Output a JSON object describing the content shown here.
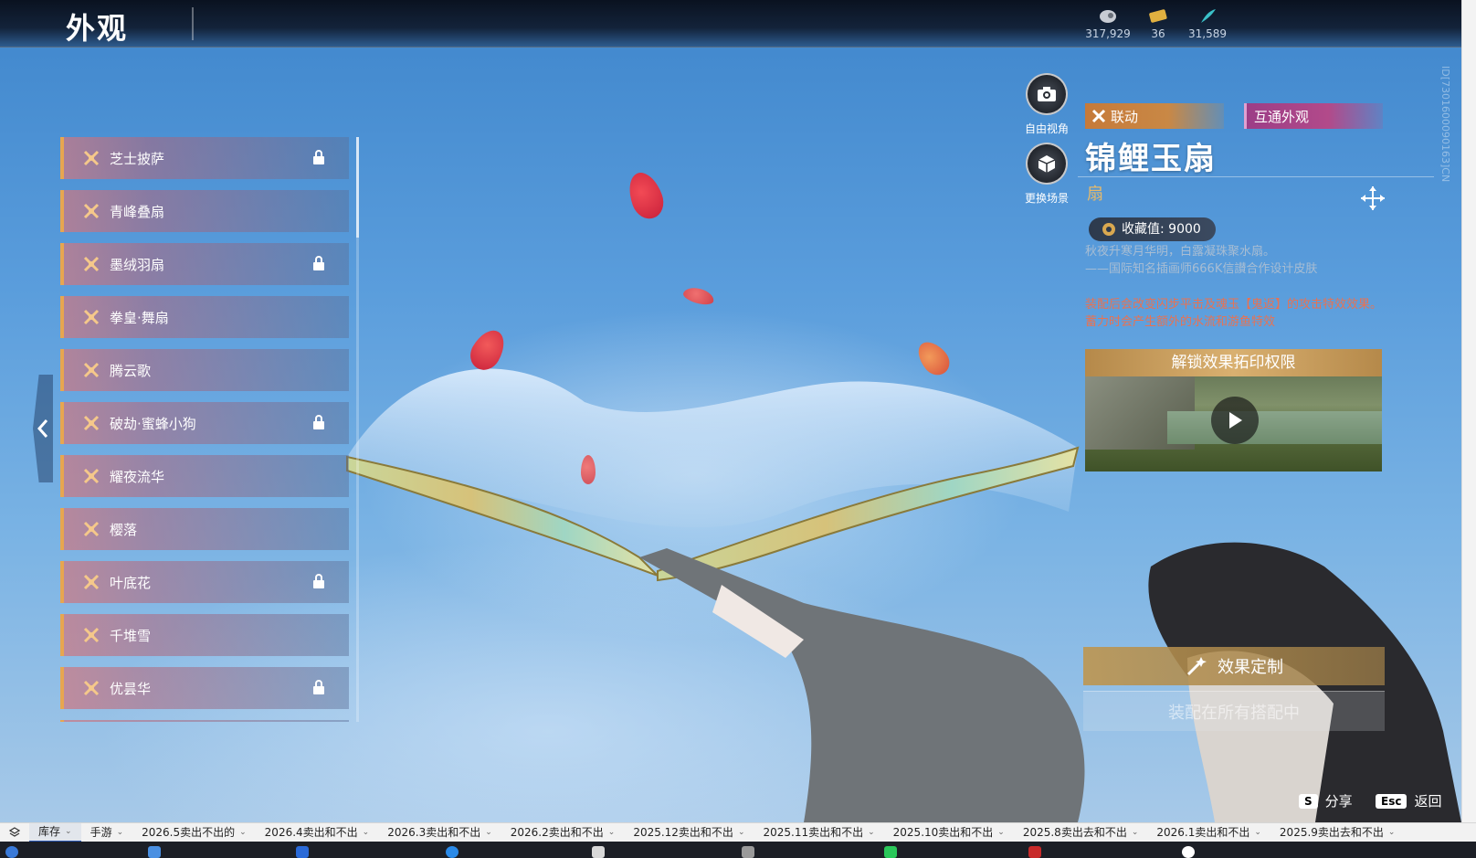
{
  "header": {
    "title": "外观",
    "currencies": [
      {
        "icon": "shell-currency-icon",
        "value": "317,929"
      },
      {
        "icon": "ticket-currency-icon",
        "value": "36"
      },
      {
        "icon": "feather-currency-icon",
        "value": "31,589"
      }
    ]
  },
  "camera": {
    "free_view_label": "自由视角",
    "change_scene_label": "更换场景"
  },
  "skin_list": [
    {
      "name": "芝士披萨",
      "locked": true
    },
    {
      "name": "青峰叠扇",
      "locked": false
    },
    {
      "name": "墨绒羽扇",
      "locked": true
    },
    {
      "name": "拳皇·舞扇",
      "locked": false
    },
    {
      "name": "腾云歌",
      "locked": false
    },
    {
      "name": "破劫·蜜蜂小狗",
      "locked": true
    },
    {
      "name": "耀夜流华",
      "locked": false
    },
    {
      "name": "樱落",
      "locked": false
    },
    {
      "name": "叶底花",
      "locked": true
    },
    {
      "name": "千堆雪",
      "locked": false
    },
    {
      "name": "优昙华",
      "locked": true
    }
  ],
  "detail": {
    "tag_collab": "联动",
    "tag_shared": "互通外观",
    "name": "锦鲤玉扇",
    "type": "扇",
    "collect_value": "收藏值: 9000",
    "desc_line1": "秋夜升寒月华明，白露凝珠聚水扇。",
    "desc_line2": "——国际知名插画师666K信讃合作设计皮肤",
    "effect_line1": "装配后会改变闪步平击及魂玉【鬼返】的攻击特效效果。",
    "effect_line2": "蓄力时会产生额外的水流和游鱼特效",
    "unlock_title": "解锁效果拓印权限",
    "customize_label": "效果定制",
    "equip_label": "装配在所有搭配中"
  },
  "hotkeys": {
    "share_key": "S",
    "share_label": "分享",
    "back_key": "Esc",
    "back_label": "返回"
  },
  "vertical_id": "ID[7301600090163]CN",
  "bookmarks": [
    {
      "label": "库存",
      "active": true
    },
    {
      "label": "手游",
      "active": false
    },
    {
      "label": "2026.5卖出不出的",
      "active": false
    },
    {
      "label": "2026.4卖出和不出",
      "active": false
    },
    {
      "label": "2026.3卖出和不出",
      "active": false
    },
    {
      "label": "2026.2卖出和不出",
      "active": false
    },
    {
      "label": "2025.12卖出和不出",
      "active": false
    },
    {
      "label": "2025.11卖出和不出",
      "active": false
    },
    {
      "label": "2025.10卖出和不出",
      "active": false
    },
    {
      "label": "2025.8卖出去和不出",
      "active": false
    },
    {
      "label": "2026.1卖出和不出",
      "active": false
    },
    {
      "label": "2025.9卖出去和不出",
      "active": false
    }
  ],
  "colors": {
    "accent_gold": "#e7a650",
    "effect_red": "#e87252",
    "collab_orange": "#c67a3a",
    "shared_purple": "#9c3d87"
  }
}
